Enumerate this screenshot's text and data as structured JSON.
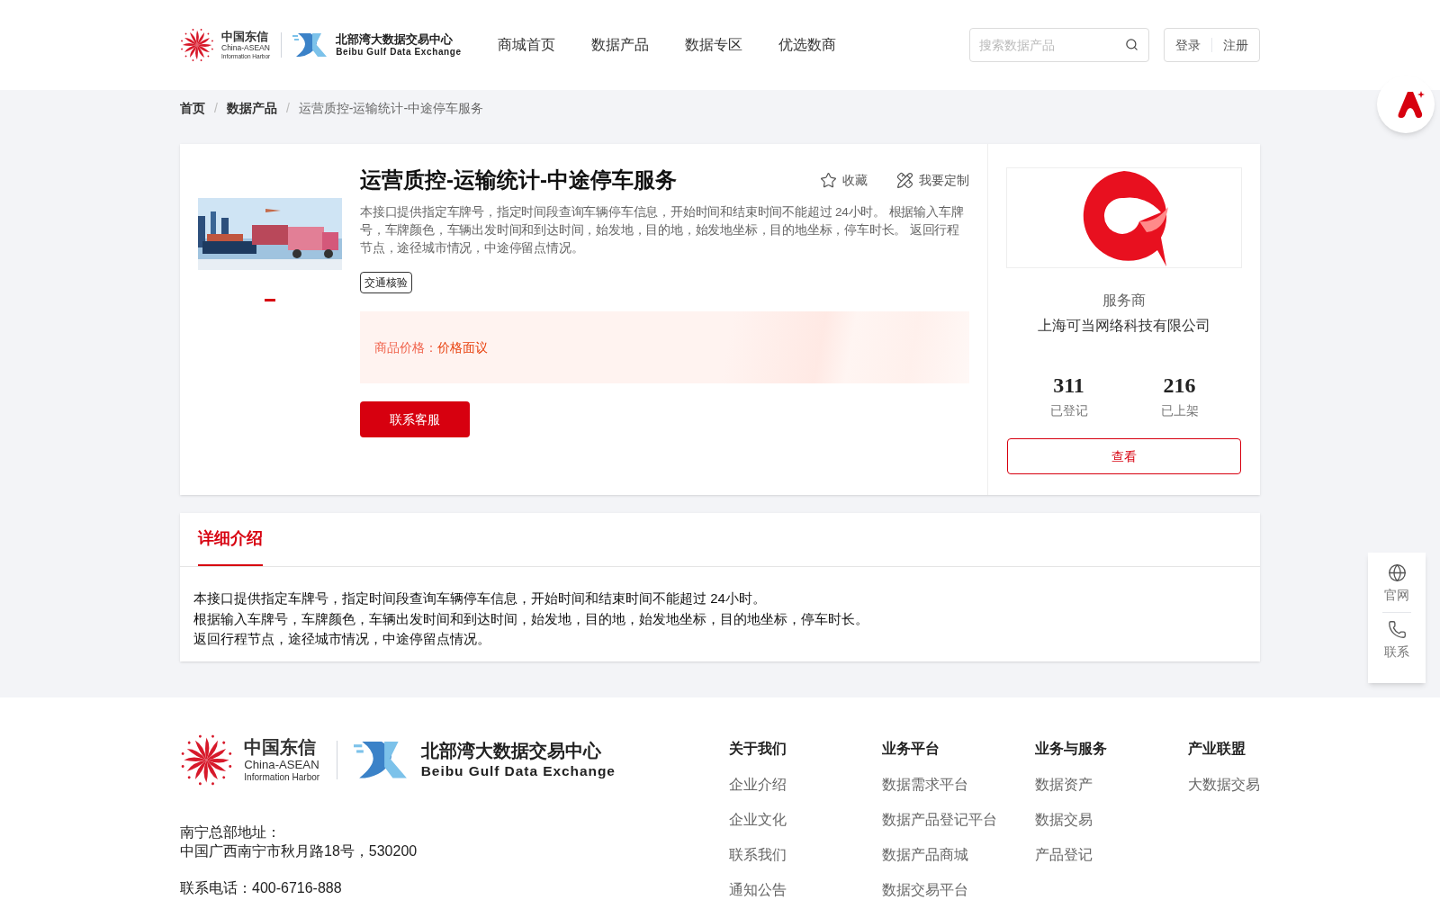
{
  "header": {
    "logo": {
      "cn_name": "中国东信",
      "en_name_1": "China-ASEAN",
      "en_name_2": "Information Harbor",
      "exchange_cn": "北部湾大数据交易中心",
      "exchange_en": "Beibu Gulf Data Exchange"
    },
    "nav": [
      {
        "label": "商城首页",
        "selected": false
      },
      {
        "label": "数据产品",
        "selected": false
      },
      {
        "label": "数据专区",
        "selected": false
      },
      {
        "label": "优选数商",
        "selected": false
      }
    ],
    "search": {
      "placeholder": "搜索数据产品"
    },
    "auth": [
      "登录",
      "注册"
    ]
  },
  "breadcrumb": {
    "separator": "/",
    "items": [
      "首页",
      "数据产品",
      "运营质控-运输统计-中途停车服务"
    ]
  },
  "product": {
    "title": "运营质控-运输统计-中途停车服务",
    "actions": [
      {
        "kind": "favorite",
        "label": "收藏"
      },
      {
        "kind": "customize",
        "label": "我要定制"
      }
    ],
    "description": "本接口提供指定车牌号，指定时间段查询车辆停车信息，开始时间和结束时间不能超过 24小时。 根据输入车牌号，车牌颜色，车辆出发时间和到达时间，始发地，目的地，始发地坐标，目的地坐标，停车时长。 返回行程节点，途径城市情况，中途停留点情况。",
    "tags": [
      "交通核验"
    ],
    "price_label": "商品价格：",
    "price_value": "价格面议",
    "contact_button": "联系客服",
    "carousel": [
      {
        "selected": true
      }
    ]
  },
  "provider": {
    "label": "服务商",
    "name": "上海可当网络科技有限公司",
    "stats": [
      {
        "value": "311",
        "label": "已登记"
      },
      {
        "value": "216",
        "label": "已上架"
      }
    ],
    "button": "查看"
  },
  "detail": {
    "tabs": [
      {
        "label": "详细介绍",
        "selected": true
      }
    ],
    "lines": [
      "本接口提供指定车牌号，指定时间段查询车辆停车信息，开始时间和结束时间不能超过 24小时。",
      "根据输入车牌号，车牌颜色，车辆出发时间和到达时间，始发地，目的地，始发地坐标，目的地坐标，停车时长。",
      "返回行程节点，途径城市情况，中途停留点情况。"
    ]
  },
  "side_panel": [
    {
      "kind": "globe",
      "label": "官网"
    },
    {
      "kind": "phone",
      "label": "联系"
    }
  ],
  "footer": {
    "logo": {
      "cn_name": "中国东信",
      "en_name_1": "China-ASEAN",
      "en_name_2": "Information Harbor",
      "exchange_cn": "北部湾大数据交易中心",
      "exchange_en": "Beibu Gulf Data Exchange"
    },
    "address_label": "南宁总部地址：",
    "address": "中国广西南宁市秋月路18号，530200",
    "phone": "联系电话：400-6716-888",
    "columns": [
      {
        "title": "关于我们",
        "links": [
          "企业介绍",
          "企业文化",
          "联系我们",
          "通知公告"
        ]
      },
      {
        "title": "业务平台",
        "links": [
          "数据需求平台",
          "数据产品登记平台",
          "数据产品商城",
          "数据交易平台"
        ]
      },
      {
        "title": "业务与服务",
        "links": [
          "数据资产",
          "数据交易",
          "产品登记"
        ]
      },
      {
        "title": "产业联盟",
        "links": [
          "大数据交易"
        ]
      }
    ]
  }
}
